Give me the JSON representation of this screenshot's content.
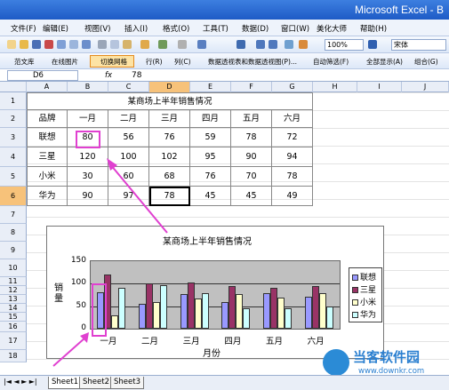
{
  "window": {
    "title": "Microsoft Excel - B"
  },
  "menu": [
    "文件(F)",
    "编辑(E)",
    "视图(V)",
    "插入(I)",
    "格式(O)",
    "工具(T)",
    "数据(D)",
    "窗口(W)",
    "美化大师",
    "帮助(H)"
  ],
  "toolbar": {
    "zoom": "100%",
    "font": "宋体"
  },
  "toolbar2": {
    "items": [
      "范文库",
      "在线图片",
      "切换网格",
      "行(R)",
      "列(C)",
      "数据透视表和数据透视图(P)...",
      "自动筛选(F)",
      "全部显示(A)",
      "组合(G)"
    ]
  },
  "formula": {
    "cell_ref": "D6",
    "fx": "fx",
    "value": "78"
  },
  "columns": [
    "A",
    "B",
    "C",
    "D",
    "E",
    "F",
    "G",
    "H",
    "I",
    "J"
  ],
  "rows": [
    "1",
    "2",
    "3",
    "4",
    "5",
    "6",
    "7",
    "8",
    "9",
    "10",
    "11",
    "12",
    "13",
    "14",
    "15",
    "16",
    "17",
    "18"
  ],
  "table": {
    "title": "某商场上半年销售情况",
    "headers": [
      "品牌",
      "一月",
      "二月",
      "三月",
      "四月",
      "五月",
      "六月"
    ],
    "rows": [
      [
        "联想",
        "80",
        "56",
        "76",
        "59",
        "78",
        "72"
      ],
      [
        "三星",
        "120",
        "100",
        "102",
        "95",
        "90",
        "94"
      ],
      [
        "小米",
        "30",
        "60",
        "68",
        "76",
        "70",
        "78"
      ],
      [
        "华为",
        "90",
        "97",
        "78",
        "45",
        "45",
        "49"
      ]
    ]
  },
  "chart_data": {
    "type": "bar",
    "title": "某商场上半年销售情况",
    "xlabel": "月份",
    "ylabel": "销量",
    "categories": [
      "一月",
      "二月",
      "三月",
      "四月",
      "五月",
      "六月"
    ],
    "series": [
      {
        "name": "联想",
        "values": [
          80,
          56,
          76,
          59,
          78,
          72
        ],
        "color": "#9999ff"
      },
      {
        "name": "三星",
        "values": [
          120,
          100,
          102,
          95,
          90,
          94
        ],
        "color": "#993366"
      },
      {
        "name": "小米",
        "values": [
          30,
          60,
          68,
          76,
          70,
          78
        ],
        "color": "#ffffcc"
      },
      {
        "name": "华为",
        "values": [
          90,
          97,
          78,
          45,
          45,
          49
        ],
        "color": "#ccffff"
      }
    ],
    "ylim": [
      0,
      150
    ],
    "yticks": [
      "0",
      "50",
      "100",
      "150"
    ],
    "grid": true,
    "legend": "right"
  },
  "sheets": [
    "Sheet1",
    "Sheet2",
    "Sheet3"
  ],
  "watermark": {
    "name": "当客软件园",
    "url": "www.downkr.com"
  }
}
